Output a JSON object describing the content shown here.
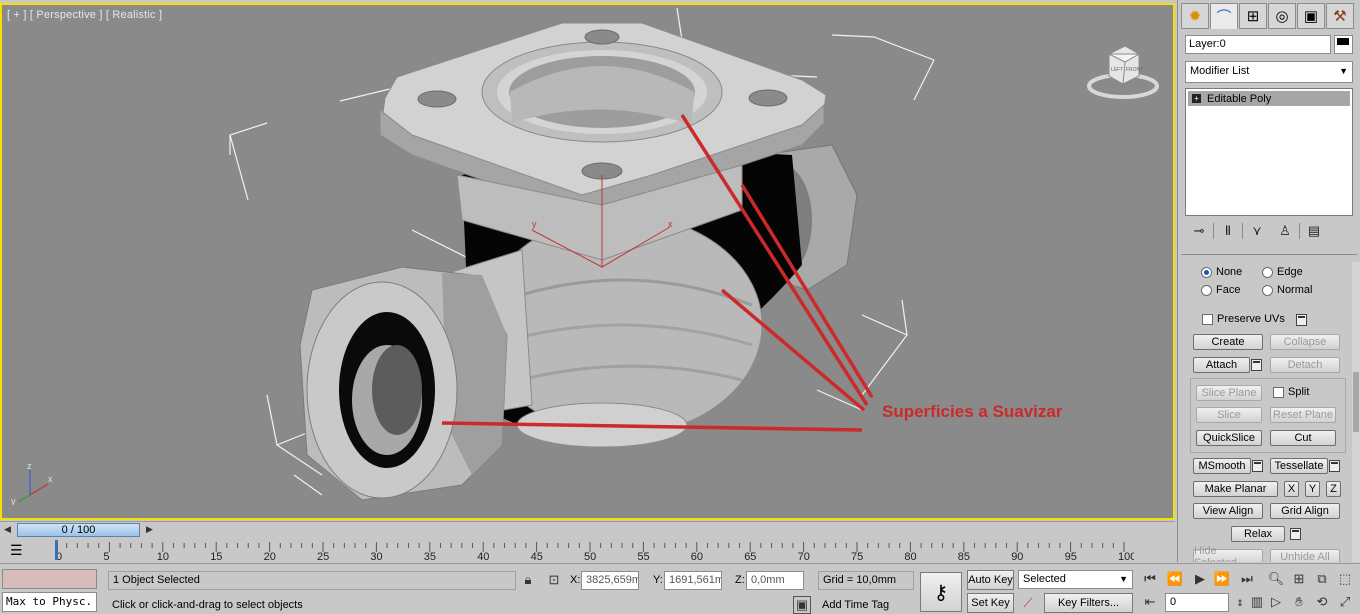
{
  "viewport": {
    "label": "[ + ] [ Perspective ] [ Realistic ]",
    "annotation": "Superficies a Suavizar",
    "viewcube_faces": [
      "LEFT",
      "FRONT"
    ],
    "axes": {
      "x": "x",
      "y": "y",
      "z": "z"
    },
    "gizmo_axes": {
      "x": "x",
      "y": "y"
    },
    "border_color": "#f3e200"
  },
  "command_panel": {
    "tabs": [
      "create-icon",
      "modify-icon",
      "hierarchy-icon",
      "motion-icon",
      "display-icon",
      "utilities-icon"
    ],
    "layer": "Layer:0",
    "modifier_list": "Modifier List",
    "stack_item": "Editable Poly",
    "preserve_uvs": "Preserve UVs",
    "radios": {
      "none": "None",
      "edge": "Edge",
      "face": "Face",
      "normal": "Normal"
    },
    "buttons": {
      "create": "Create",
      "collapse": "Collapse",
      "attach": "Attach",
      "detach": "Detach",
      "slice_plane": "Slice Plane",
      "split": "Split",
      "slice": "Slice",
      "reset_plane": "Reset Plane",
      "quickslice": "QuickSlice",
      "cut": "Cut",
      "msmooth": "MSmooth",
      "tessellate": "Tessellate",
      "make_planar": "Make Planar",
      "x": "X",
      "y": "Y",
      "z": "Z",
      "view_align": "View Align",
      "grid_align": "Grid Align",
      "relax": "Relax",
      "hide_selected": "Hide Selected",
      "unhide_all": "Unhide All"
    }
  },
  "time": {
    "slider_label": "0 / 100",
    "ticks": [
      0,
      5,
      10,
      15,
      20,
      25,
      30,
      35,
      40,
      45,
      50,
      55,
      60,
      65,
      70,
      75,
      80,
      85,
      90,
      95,
      100
    ]
  },
  "status": {
    "listener": "Max to Physc.",
    "selection": "1 Object Selected",
    "prompt": "Click or click-and-drag to select objects",
    "x_label": "X:",
    "x_value": "3825,659m",
    "y_label": "Y:",
    "y_value": "1691,561m",
    "z_label": "Z:",
    "z_value": "0,0mm",
    "grid": "Grid = 10,0mm",
    "add_time_tag": "Add Time Tag",
    "auto_key": "Auto Key",
    "set_key": "Set Key",
    "selected": "Selected",
    "key_filters": "Key Filters...",
    "frame": "0"
  }
}
